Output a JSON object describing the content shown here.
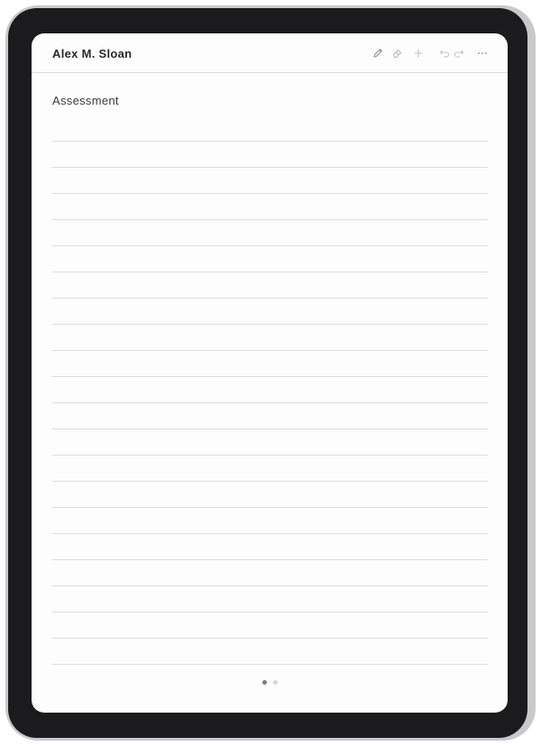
{
  "header": {
    "owner_name": "Alex M. Sloan",
    "tools": [
      {
        "icon": "pencil-icon"
      },
      {
        "icon": "eraser-icon"
      },
      {
        "icon": "plus-icon"
      },
      {
        "icon": "undo-icon"
      },
      {
        "icon": "redo-icon"
      },
      {
        "icon": "more-icon"
      }
    ]
  },
  "page": {
    "section_title": "Assessment",
    "ruled_line_count": 21
  },
  "pagination": {
    "current_page": 1,
    "total_pages": 2
  },
  "colors": {
    "device_frame": "#1b1b1d",
    "screen_background": "#fdfdfd",
    "rule_line": "#dedede",
    "icon_gray": "#b8b8b8"
  }
}
